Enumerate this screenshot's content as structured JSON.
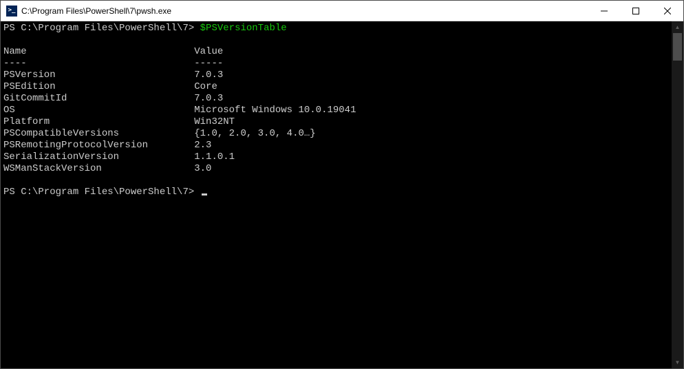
{
  "window": {
    "title": "C:\\Program Files\\PowerShell\\7\\pwsh.exe",
    "icon_glyph": ">_"
  },
  "terminal": {
    "prompt1_prefix": "PS C:\\Program Files\\PowerShell\\7> ",
    "command1": "$PSVersionTable",
    "headers": {
      "name": "Name",
      "value": "Value",
      "name_rule": "----",
      "value_rule": "-----"
    },
    "rows": [
      {
        "name": "PSVersion",
        "value": "7.0.3"
      },
      {
        "name": "PSEdition",
        "value": "Core"
      },
      {
        "name": "GitCommitId",
        "value": "7.0.3"
      },
      {
        "name": "OS",
        "value": "Microsoft Windows 10.0.19041"
      },
      {
        "name": "Platform",
        "value": "Win32NT"
      },
      {
        "name": "PSCompatibleVersions",
        "value": "{1.0, 2.0, 3.0, 4.0…}"
      },
      {
        "name": "PSRemotingProtocolVersion",
        "value": "2.3"
      },
      {
        "name": "SerializationVersion",
        "value": "1.1.0.1"
      },
      {
        "name": "WSManStackVersion",
        "value": "3.0"
      }
    ],
    "prompt2_prefix": "PS C:\\Program Files\\PowerShell\\7> "
  }
}
